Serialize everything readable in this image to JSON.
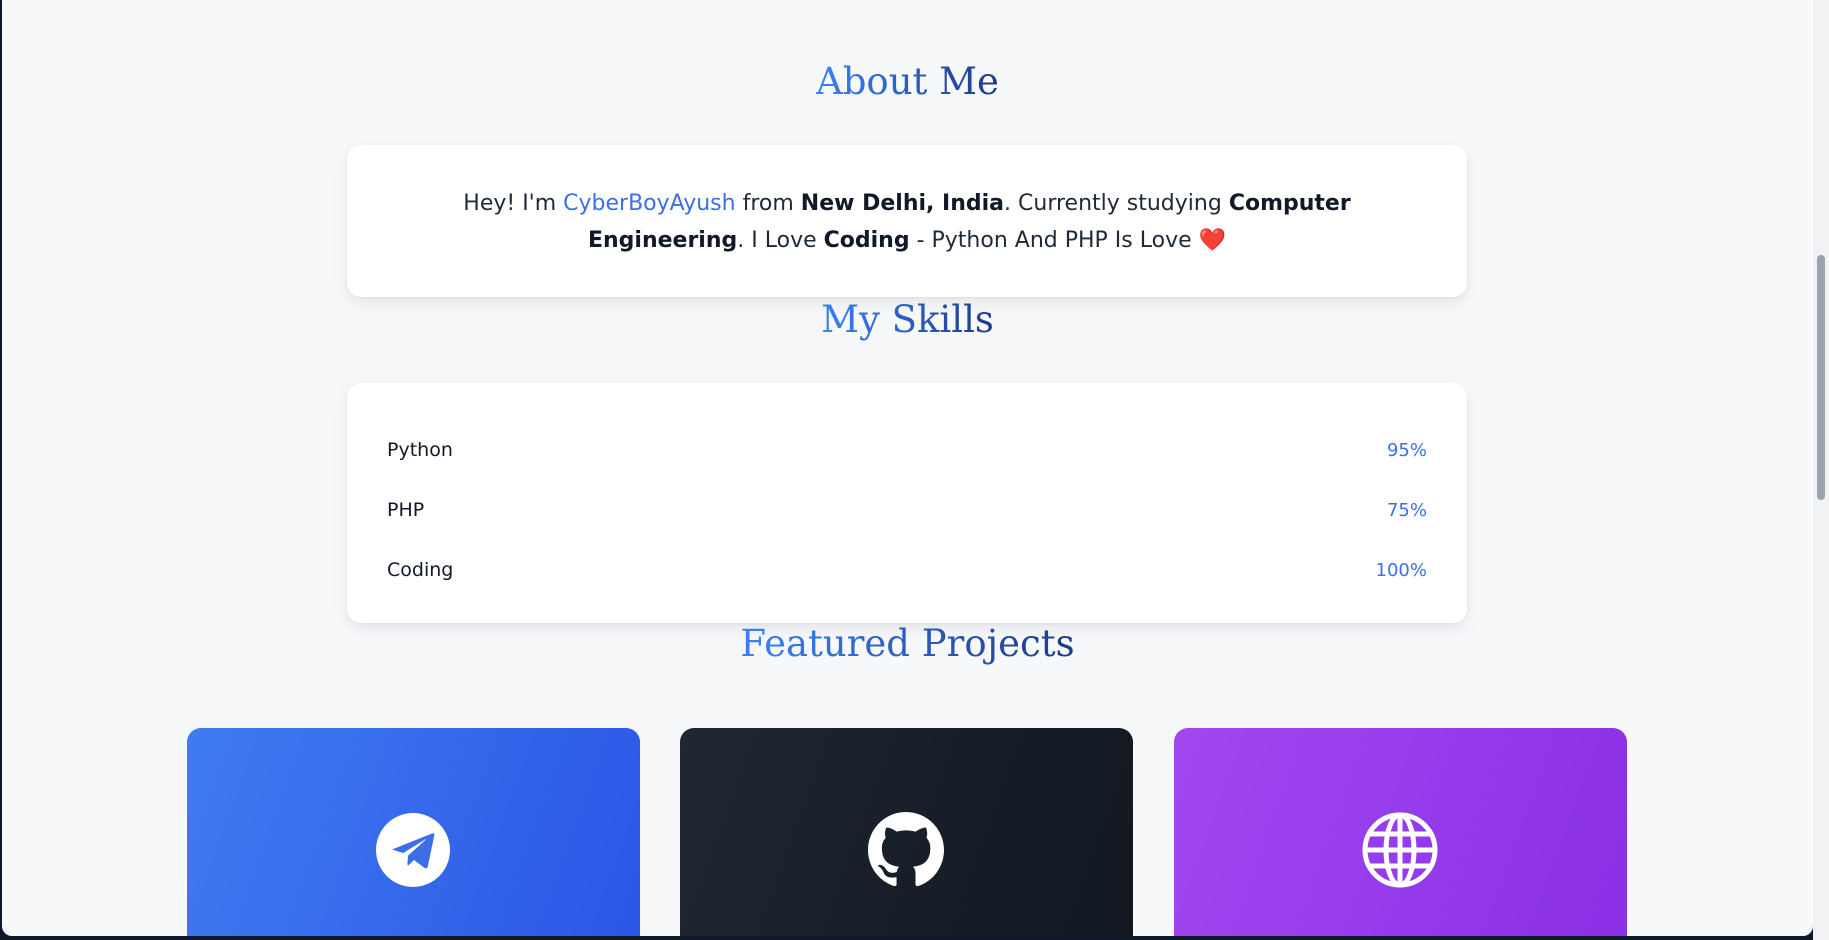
{
  "about": {
    "title": "About Me",
    "intro_prefix": "Hey! I'm ",
    "name": "CyberBoyAyush",
    "from_text": " from ",
    "location": "New Delhi, India",
    "study_text": ". Currently studying ",
    "field": "Computer Engineering",
    "love_text": ". I Love ",
    "love_subject": "Coding",
    "suffix": " - Python And PHP Is Love ",
    "heart": "❤️"
  },
  "skills": {
    "title": "My Skills",
    "items": [
      {
        "name": "Python",
        "percent_label": "95%",
        "level": 0.95
      },
      {
        "name": "PHP",
        "percent_label": "75%",
        "level": 0.75
      },
      {
        "name": "Coding",
        "percent_label": "100%",
        "level": 1.0
      }
    ]
  },
  "projects": {
    "title": "Featured Projects",
    "cards": [
      {
        "icon": "telegram-icon",
        "color_from": "#3f7cf0",
        "color_to": "#2b55e6"
      },
      {
        "icon": "github-icon",
        "color_from": "#1f2733",
        "color_to": "#111720"
      },
      {
        "icon": "globe-icon",
        "color_from": "#a148f0",
        "color_to": "#8a2fe6"
      }
    ]
  },
  "colors": {
    "accent": "#3b6fe8",
    "title_gradient_start": "#3b82f6",
    "title_gradient_end": "#1e3a8a",
    "page_background": "#f7f8fa"
  }
}
